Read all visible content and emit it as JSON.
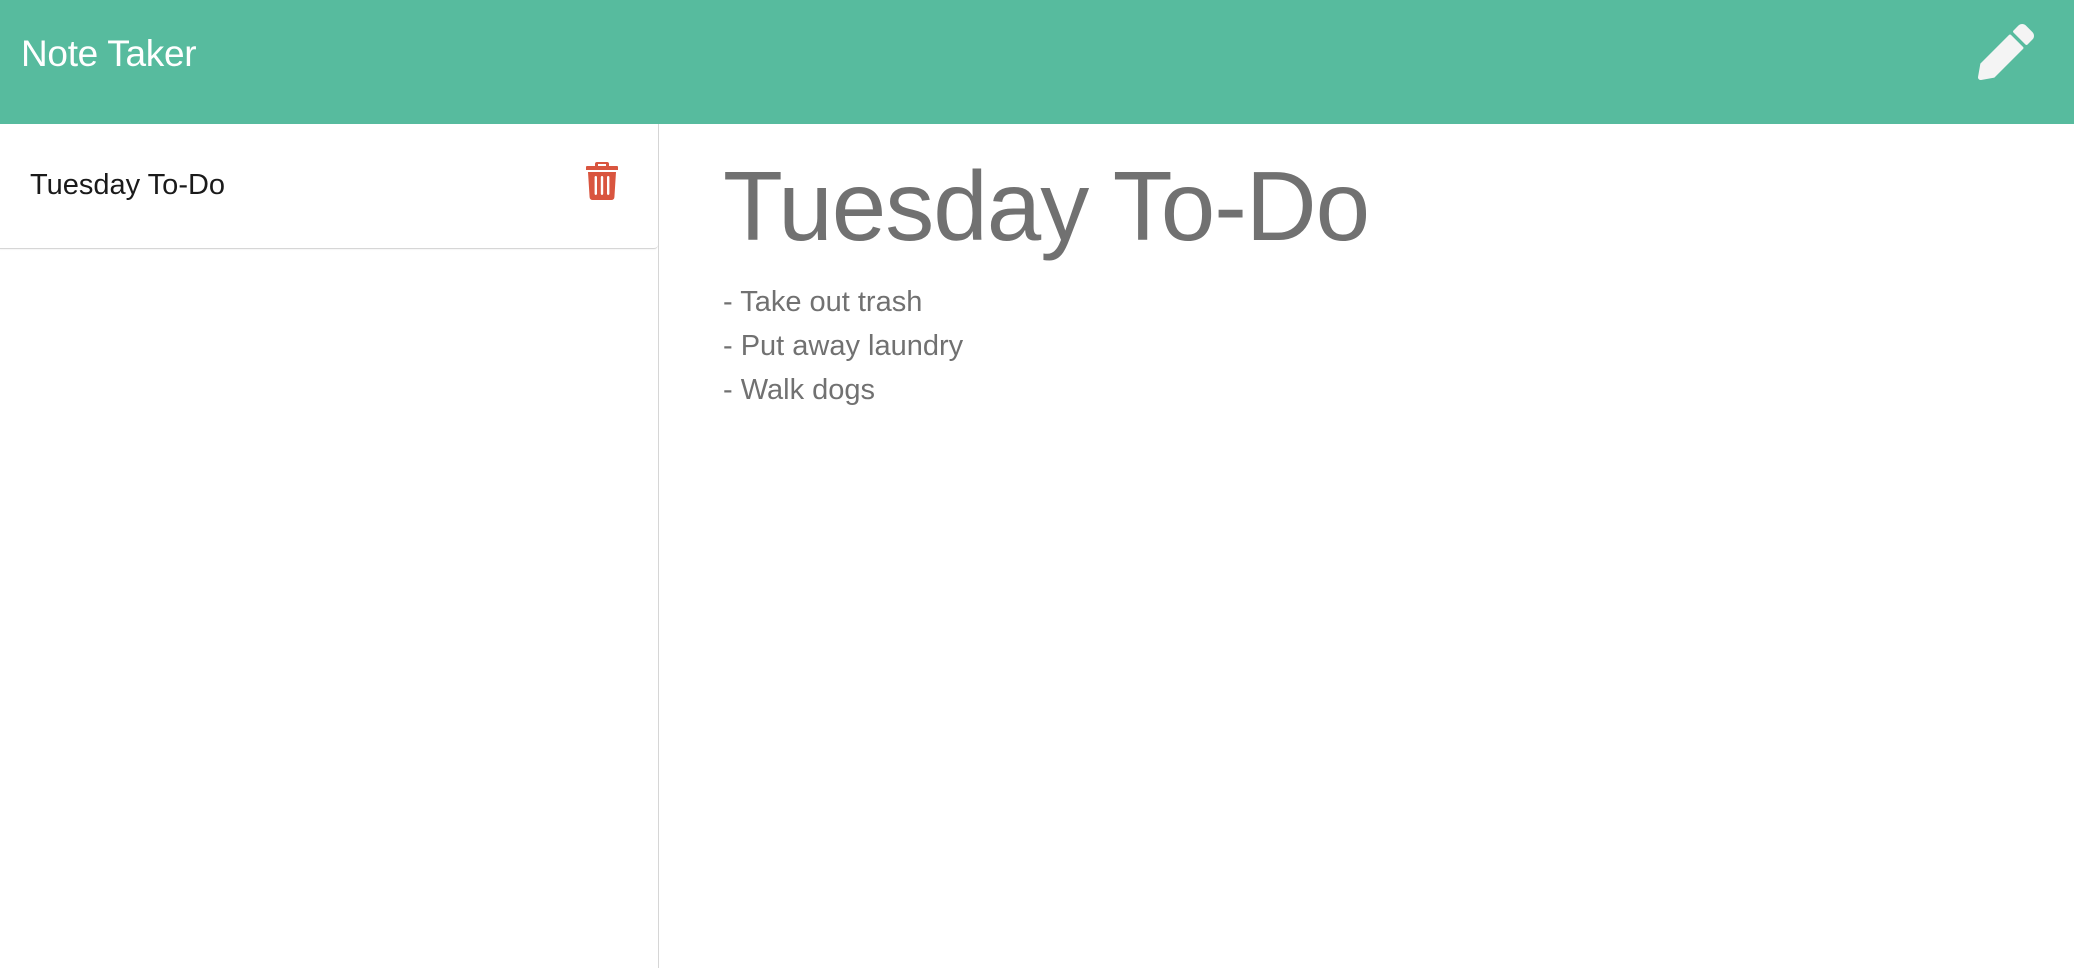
{
  "header": {
    "app_title": "Note Taker",
    "new_note_icon": "pencil-icon",
    "bg_color": "#57bb9e"
  },
  "sidebar": {
    "notes": [
      {
        "title": "Tuesday To-Do",
        "delete_icon": "trash-icon",
        "delete_color": "#d9553f"
      }
    ]
  },
  "editor": {
    "title": "Tuesday To-Do",
    "body_lines": [
      "- Take out trash",
      "- Put away laundry",
      "- Walk dogs"
    ],
    "text_color": "#717171"
  }
}
